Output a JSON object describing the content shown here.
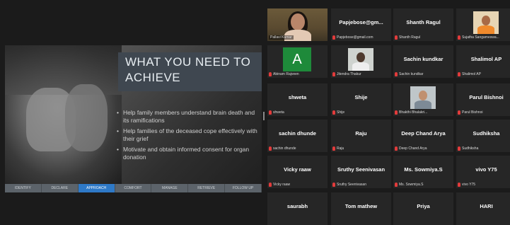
{
  "slide": {
    "title": "WHAT YOU NEED TO ACHIEVE",
    "bullets": [
      "Help family members understand brain death and its ramifications",
      "Help families of the deceased cope effectively with their grief",
      "Motivate and obtain informed consent for organ donation"
    ],
    "steps": [
      "IDENTIFY",
      "DECLARE",
      "APPROACH",
      "COMFORT",
      "MANAGE",
      "RETRIEVE",
      "FOLLOW UP"
    ],
    "active_step": "APPROACH"
  },
  "participants": [
    {
      "name": "",
      "label": "Pallavi Kumar",
      "type": "video-speaker"
    },
    {
      "name": "Papjebose@gm...",
      "label": "Papjebose@gmail.com",
      "type": "name"
    },
    {
      "name": "Shanth Ragul",
      "label": "Shanth Ragul",
      "type": "name"
    },
    {
      "name": "",
      "label": "Sujatha Sangameswa...",
      "type": "photo-warm"
    },
    {
      "name": "A",
      "label": "Abinam Rajveen",
      "type": "letter"
    },
    {
      "name": "",
      "label": "Jitendra Thakur",
      "type": "photo"
    },
    {
      "name": "Sachin kundkar",
      "label": "Sachin kundkar",
      "type": "name"
    },
    {
      "name": "Shalimol AP",
      "label": "Shalimol AP",
      "type": "name"
    },
    {
      "name": "shweta",
      "label": "shweta",
      "type": "name"
    },
    {
      "name": "Shije",
      "label": "Shije",
      "type": "name"
    },
    {
      "name": "",
      "label": "Bhakthi Bhalakri...",
      "type": "photo-kid"
    },
    {
      "name": "Parul Bishnoi",
      "label": "Parul Bishnoi",
      "type": "name"
    },
    {
      "name": "sachin dhunde",
      "label": "sachin dhunde",
      "type": "name"
    },
    {
      "name": "Raju",
      "label": "Raju",
      "type": "name"
    },
    {
      "name": "Deep Chand Arya",
      "label": "Deep Chand Arya",
      "type": "name"
    },
    {
      "name": "Sudhiksha",
      "label": "Sudhiksha",
      "type": "name"
    },
    {
      "name": "Vicky raaw",
      "label": "Vicky raaw",
      "type": "name"
    },
    {
      "name": "Sruthy Seenivasan",
      "label": "Sruthy Seenivasan",
      "type": "name"
    },
    {
      "name": "Ms. Sowmiya.S",
      "label": "Ms. Sowmiya.S",
      "type": "name"
    },
    {
      "name": "vivo Y75",
      "label": "vivo Y75",
      "type": "name"
    },
    {
      "name": "saurabh",
      "label": "",
      "type": "name"
    },
    {
      "name": "Tom mathew",
      "label": "",
      "type": "name"
    },
    {
      "name": "Priya",
      "label": "",
      "type": "name"
    },
    {
      "name": "HARI",
      "label": "",
      "type": "name"
    }
  ],
  "colors": {
    "active_speaker_border": "#c9d34a",
    "mic_muted": "#e23b3b",
    "active_step": "#2e79c7",
    "avatar_green": "#1e8a3a"
  }
}
